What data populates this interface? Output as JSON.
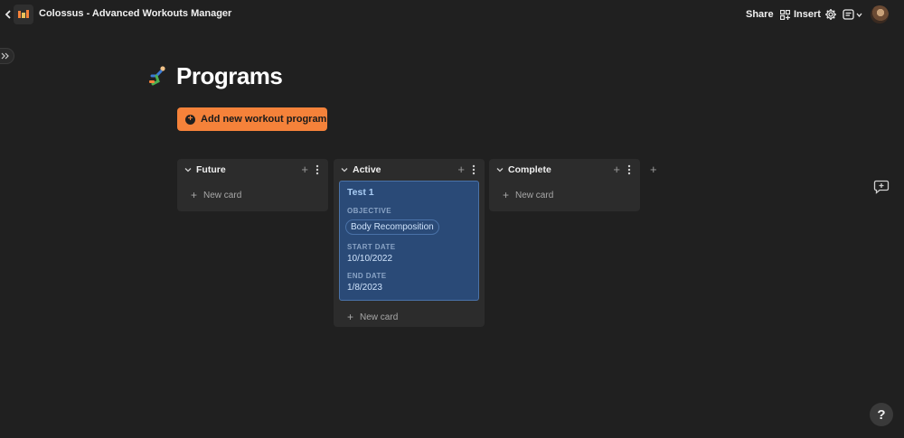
{
  "app": {
    "title": "Colossus - Advanced Workouts Manager"
  },
  "toolbar": {
    "share_label": "Share",
    "insert_label": "Insert"
  },
  "page": {
    "title": "Programs"
  },
  "actions": {
    "add_program_label": "Add new workout program"
  },
  "board": {
    "new_card_label": "New card",
    "columns": [
      {
        "name": "Future"
      },
      {
        "name": "Active"
      },
      {
        "name": "Complete"
      }
    ],
    "cards": [
      {
        "title": "Test 1",
        "objective_label": "OBJECTIVE",
        "objective": "Body Recomposition",
        "start_label": "START DATE",
        "start": "10/10/2022",
        "end_label": "END DATE",
        "end": "1/8/2023"
      }
    ]
  },
  "help": {
    "label": "?"
  },
  "colors": {
    "background": "#202020",
    "accent": "#f5823a",
    "card": "#2a4a77",
    "column": "#2c2c2c"
  }
}
